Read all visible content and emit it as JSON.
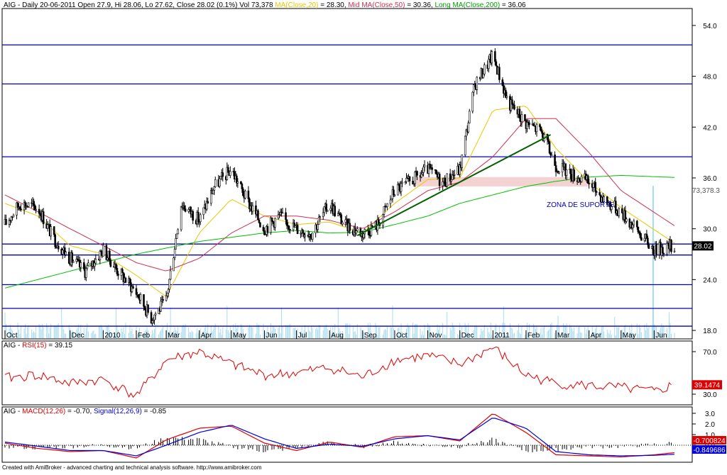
{
  "header": {
    "symbol": "AIG",
    "summary": "Daily 20-06-2011 Open 27.9, Hi 28.06, Lo 27.62, Close 28.02 (0.1%) Vol 73,378",
    "ma20": "MA(Close,20)",
    "ma20_value": " = 28.30,",
    "ma50": "Mid MA(Close,50)",
    "ma50_value": " = 30.36,",
    "ma200": "Long MA(Close,200)",
    "ma200_value": " = 36.06"
  },
  "annotation": "ZONA DE SUPORTE",
  "footer": "Created with AmiBroker - advanced charting and technical analysis software. http://www.amibroker.com",
  "colors": {
    "candle": "#000000",
    "ma20": "#e8c800",
    "ma50": "#d03050",
    "ma200": "#00c000",
    "support": "#0000c0",
    "trend": "#006000",
    "volume": "#a8dcf0",
    "rsi": "#e00000",
    "macd": "#e00000",
    "signal": "#0000e0",
    "zone": "#f5d2d2"
  },
  "chart_data": [
    {
      "type": "line",
      "subtype": "candlestick",
      "x_range": [
        "2009-10-01",
        "2011-06-20"
      ],
      "ylim": [
        17.0,
        56.0
      ],
      "y_ticks": [
        "54.0",
        "48.0",
        "42.0",
        "36.0",
        "30.0",
        "24.0",
        "18.0"
      ],
      "x_ticks": [
        "Oct",
        "Dec",
        "2010",
        "Feb",
        "Mar",
        "Apr",
        "May",
        "Jun",
        "Jul",
        "Aug",
        "Sep",
        "Oct",
        "Nov",
        "Dec",
        "2011",
        "Feb",
        "Mar",
        "Apr",
        "May",
        "Jun"
      ],
      "last_close_label": "28.02",
      "last_volume_label": "73,378.3",
      "support_levels": [
        51.7,
        47.1,
        38.5,
        28.2,
        26.9,
        23.4,
        20.6,
        18.5
      ],
      "resistance_zone": [
        35.0,
        36.1
      ],
      "trendline": [
        {
          "x": "2010-08-27",
          "y": 29.2
        },
        {
          "x": "2011-02-24",
          "y": 41.1
        }
      ],
      "series": [
        {
          "name": "Close",
          "x": [
            "2009-10-01",
            "2009-10-15",
            "2009-11-01",
            "2009-11-15",
            "2009-12-01",
            "2009-12-15",
            "2010-01-01",
            "2010-01-15",
            "2010-02-01",
            "2010-02-15",
            "2010-03-01",
            "2010-03-15",
            "2010-04-01",
            "2010-04-15",
            "2010-05-01",
            "2010-05-15",
            "2010-06-01",
            "2010-06-15",
            "2010-07-01",
            "2010-07-15",
            "2010-08-01",
            "2010-08-15",
            "2010-09-01",
            "2010-09-15",
            "2010-10-01",
            "2010-10-15",
            "2010-11-01",
            "2010-11-15",
            "2010-12-01",
            "2010-12-15",
            "2011-01-01",
            "2011-01-15",
            "2011-02-01",
            "2011-02-15",
            "2011-03-01",
            "2011-03-15",
            "2011-04-01",
            "2011-04-15",
            "2011-05-01",
            "2011-05-15",
            "2011-06-01",
            "2011-06-20"
          ],
          "values": [
            30.5,
            33.0,
            32.5,
            29.0,
            26.5,
            25.0,
            27.5,
            25.0,
            22.5,
            19.5,
            21.5,
            33.0,
            31.0,
            35.0,
            37.0,
            33.5,
            30.0,
            31.5,
            30.0,
            29.5,
            33.0,
            30.5,
            29.5,
            30.5,
            34.5,
            35.5,
            37.0,
            35.5,
            37.0,
            47.0,
            50.5,
            45.0,
            42.5,
            41.5,
            37.5,
            36.5,
            35.5,
            33.5,
            32.0,
            30.0,
            27.5,
            28.02
          ]
        },
        {
          "name": "MA(Close,20)",
          "x": [
            "2009-10-01",
            "2009-11-01",
            "2009-12-01",
            "2010-01-01",
            "2010-02-01",
            "2010-03-01",
            "2010-04-01",
            "2010-05-01",
            "2010-06-01",
            "2010-07-01",
            "2010-08-01",
            "2010-09-01",
            "2010-10-01",
            "2010-11-01",
            "2010-12-01",
            "2011-01-01",
            "2011-02-01",
            "2011-03-01",
            "2011-04-01",
            "2011-05-01",
            "2011-06-20"
          ],
          "values": [
            33.0,
            31.5,
            28.0,
            27.0,
            24.5,
            22.0,
            29.5,
            33.5,
            31.5,
            30.5,
            30.8,
            29.5,
            33.0,
            35.8,
            36.0,
            44.0,
            44.5,
            39.5,
            35.5,
            32.5,
            28.3
          ]
        },
        {
          "name": "Mid MA(Close,50)",
          "x": [
            "2009-10-01",
            "2009-11-01",
            "2009-12-01",
            "2010-01-01",
            "2010-02-01",
            "2010-03-01",
            "2010-04-01",
            "2010-05-01",
            "2010-06-01",
            "2010-07-01",
            "2010-08-01",
            "2010-09-01",
            "2010-10-01",
            "2010-11-01",
            "2010-12-01",
            "2011-01-01",
            "2011-02-01",
            "2011-03-01",
            "2011-04-01",
            "2011-05-01",
            "2011-06-20"
          ],
          "values": [
            34.0,
            32.0,
            30.0,
            28.0,
            26.0,
            25.0,
            26.5,
            29.5,
            31.5,
            31.5,
            31.0,
            30.0,
            32.0,
            34.5,
            35.5,
            38.5,
            43.0,
            43.0,
            39.0,
            34.5,
            30.36
          ]
        },
        {
          "name": "Long MA(Close,200)",
          "x": [
            "2009-10-01",
            "2009-12-01",
            "2010-02-01",
            "2010-04-01",
            "2010-06-01",
            "2010-07-01",
            "2010-08-01",
            "2010-09-01",
            "2010-10-01",
            "2010-11-01",
            "2010-12-01",
            "2011-01-01",
            "2011-02-01",
            "2011-03-01",
            "2011-04-01",
            "2011-05-01",
            "2011-06-20"
          ],
          "values": [
            23.0,
            25.0,
            27.0,
            28.5,
            29.5,
            29.8,
            29.5,
            29.6,
            30.5,
            31.5,
            33.0,
            34.0,
            35.0,
            35.6,
            36.1,
            36.3,
            36.06
          ]
        }
      ]
    },
    {
      "type": "line",
      "title": "RSI(15)",
      "title_value": " = 39.15",
      "symbol": "AIG",
      "ylim": [
        20,
        80
      ],
      "y_ticks": [
        "70.0",
        "30.0"
      ],
      "last_label": "39.1474",
      "x": [
        "2009-10-01",
        "2009-11-01",
        "2009-12-01",
        "2010-01-01",
        "2010-02-01",
        "2010-03-01",
        "2010-04-01",
        "2010-05-01",
        "2010-06-01",
        "2010-07-01",
        "2010-08-01",
        "2010-09-01",
        "2010-10-01",
        "2010-11-01",
        "2010-12-01",
        "2011-01-01",
        "2011-02-01",
        "2011-03-01",
        "2011-04-01",
        "2011-05-01",
        "2011-06-01",
        "2011-06-20"
      ],
      "values": [
        45,
        48,
        40,
        44,
        28,
        62,
        70,
        58,
        48,
        50,
        55,
        46,
        62,
        66,
        58,
        74,
        48,
        40,
        38,
        36,
        32,
        39.15
      ]
    },
    {
      "type": "line",
      "title": "MACD(12,26)",
      "title_value": " = -0.70,",
      "signal_title": "Signal(12,26,9)",
      "signal_value": " = -0.85",
      "symbol": "AIG",
      "ylim": [
        -1.6,
        3.6
      ],
      "y_ticks": [
        "3.0",
        "2.0",
        "1.0",
        "0.0"
      ],
      "macd_label": "-0.700824",
      "signal_label": "-0.849686",
      "x": [
        "2009-10-01",
        "2009-11-01",
        "2009-12-01",
        "2010-01-01",
        "2010-02-01",
        "2010-03-01",
        "2010-04-01",
        "2010-05-01",
        "2010-06-01",
        "2010-07-01",
        "2010-08-01",
        "2010-09-01",
        "2010-10-01",
        "2010-11-01",
        "2010-12-01",
        "2011-01-01",
        "2011-02-01",
        "2011-03-01",
        "2011-04-01",
        "2011-05-01",
        "2011-06-01",
        "2011-06-20"
      ],
      "series": [
        {
          "name": "MACD(12,26)",
          "values": [
            0.2,
            -0.3,
            -0.6,
            -0.5,
            -1.2,
            0.5,
            1.6,
            1.8,
            0.2,
            -0.5,
            0.3,
            -0.2,
            0.8,
            0.9,
            0.4,
            3.0,
            1.2,
            -0.9,
            -1.0,
            -1.1,
            -0.9,
            -0.7
          ]
        },
        {
          "name": "Signal(12,26,9)",
          "values": [
            0.3,
            -0.1,
            -0.5,
            -0.5,
            -1.0,
            0.0,
            1.2,
            1.9,
            0.6,
            -0.3,
            0.1,
            -0.1,
            0.6,
            0.9,
            0.5,
            2.6,
            1.6,
            -0.6,
            -0.9,
            -1.0,
            -0.95,
            -0.85
          ]
        }
      ]
    }
  ]
}
